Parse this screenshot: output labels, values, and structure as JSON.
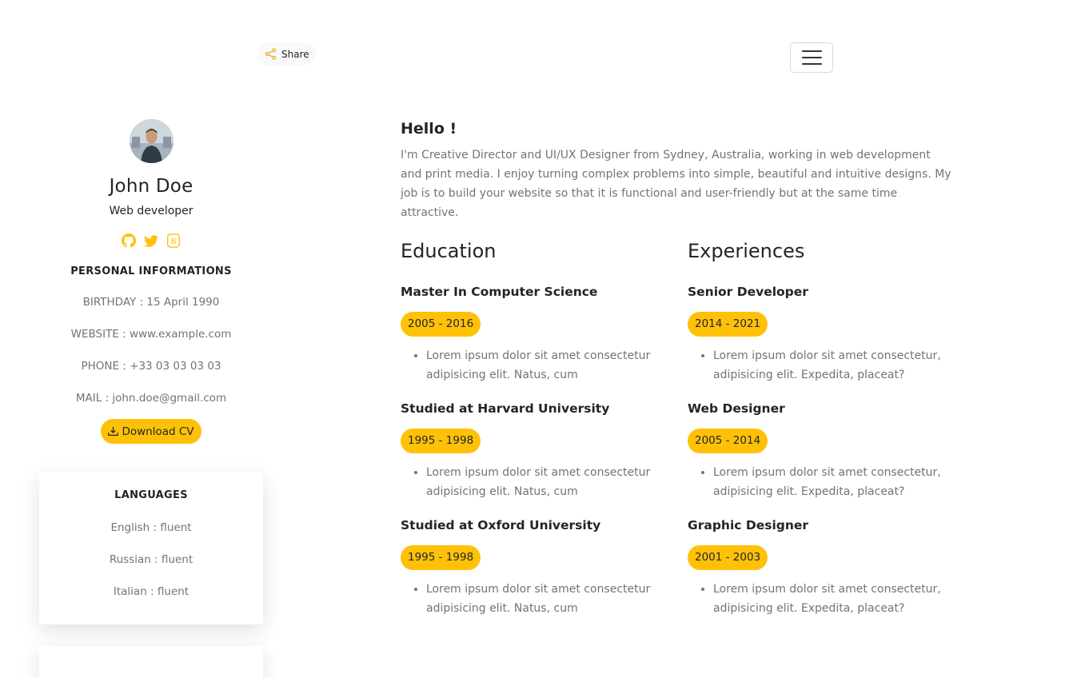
{
  "header": {
    "share_label": "Share"
  },
  "profile": {
    "name": "John Doe",
    "role": "Web developer",
    "socials": [
      "github-icon",
      "twitter-icon",
      "bitcoin-icon"
    ]
  },
  "personal": {
    "title": "PERSONAL INFORMATIONS",
    "birthday": "BIRTHDAY : 15 April 1990",
    "website": "WEBSITE : www.example.com",
    "phone": "PHONE : +33 03 03 03 03",
    "mail": "MAIL : john.doe@gmail.com",
    "download_label": "Download CV"
  },
  "languages": {
    "title": "LANGUAGES",
    "items": [
      "English : fluent",
      "Russian : fluent",
      "Italian : fluent"
    ]
  },
  "intro": {
    "heading": "Hello !",
    "text": "I'm Creative Director and UI/UX Designer from Sydney, Australia, working in web development and print media. I enjoy turning complex problems into simple, beautiful and intuitive designs. My job is to build your website so that it is functional and user-friendly but at the same time attractive."
  },
  "education": {
    "title": "Education",
    "items": [
      {
        "title": "Master In Computer Science",
        "period": "2005 - 2016",
        "desc": "Lorem ipsum dolor sit amet consectetur adipisicing elit. Natus, cum"
      },
      {
        "title": "Studied at Harvard University",
        "period": "1995 - 1998",
        "desc": "Lorem ipsum dolor sit amet consectetur adipisicing elit. Natus, cum"
      },
      {
        "title": "Studied at Oxford University",
        "period": "1995 - 1998",
        "desc": "Lorem ipsum dolor sit amet consectetur adipisicing elit. Natus, cum"
      }
    ]
  },
  "experiences": {
    "title": "Experiences",
    "items": [
      {
        "title": "Senior Developer",
        "period": "2014 - 2021",
        "desc": "Lorem ipsum dolor sit amet consectetur, adipisicing elit. Expedita, placeat?"
      },
      {
        "title": "Web Designer",
        "period": "2005 - 2014",
        "desc": "Lorem ipsum dolor sit amet consectetur, adipisicing elit. Expedita, placeat?"
      },
      {
        "title": "Graphic Designer",
        "period": "2001 - 2003",
        "desc": "Lorem ipsum dolor sit amet consectetur, adipisicing elit. Expedita, placeat?"
      }
    ]
  },
  "colors": {
    "accent": "#ffc107",
    "muted_text": "#6c757d",
    "text": "#212529"
  }
}
